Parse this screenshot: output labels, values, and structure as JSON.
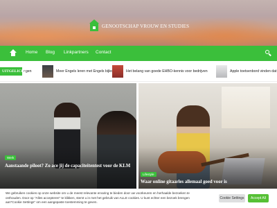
{
  "site": {
    "name": "GENOOTSCHAP VROUW EN STUDIES"
  },
  "nav": {
    "home_icon": "home-icon",
    "links": [
      "Home",
      "Blog",
      "Linkpartners",
      "Contact"
    ],
    "search_icon": "search-icon"
  },
  "ticker": {
    "label": "UITGELICHT",
    "items": [
      "ngen",
      "Meer Engels leren met Engels bijles",
      "Het belang van goede EHBO-kennis voor bedrijven",
      "Apple toetsenbord vinden dat"
    ]
  },
  "posts": [
    {
      "category": "Werk",
      "title": "Aanstaande piloot? Zo ace jij de capaciteitentest voor de KLM"
    },
    {
      "category": "Lifestyle",
      "title": "Waar online gitaarles allemaal goed voor is"
    }
  ],
  "cookie": {
    "text": "We gebruiken cookies op onze website om u de meest relevante ervaring te bieden door uw voorkeuren en herhaalde bezoeken te onthouden. Door op \"Alles accepteren\" te klikken, stemt u in met het gebruik van ALLE cookies. U kunt echter een bezoek brengen aan\"Cookie Settings\" om een aangepaste toestemming te geven.",
    "settings_label": "Cookie Settings",
    "accept_label": "Accept All"
  },
  "colors": {
    "accent": "#3bbf3b",
    "accept_button": "#56c035"
  }
}
